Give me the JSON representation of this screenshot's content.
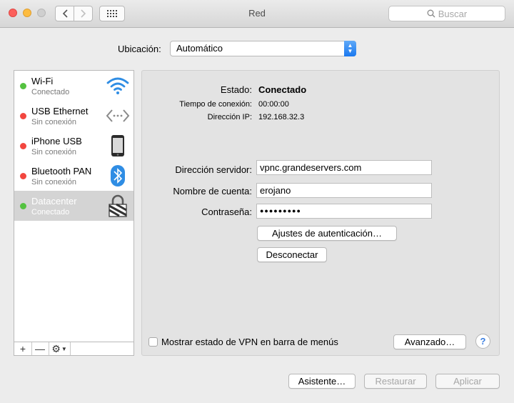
{
  "window": {
    "title": "Red",
    "search_placeholder": "Buscar"
  },
  "location": {
    "label": "Ubicación:",
    "value": "Automático"
  },
  "services": [
    {
      "name": "Wi-Fi",
      "status": "Conectado",
      "dot": "green",
      "icon": "wifi-icon"
    },
    {
      "name": "USB Ethernet",
      "status": "Sin conexión",
      "dot": "red",
      "icon": "ethernet-icon"
    },
    {
      "name": "iPhone USB",
      "status": "Sin conexión",
      "dot": "red",
      "icon": "iphone-icon"
    },
    {
      "name": "Bluetooth PAN",
      "status": "Sin conexión",
      "dot": "red",
      "icon": "bluetooth-icon"
    },
    {
      "name": "Datacenter",
      "status": "Conectado",
      "dot": "green",
      "icon": "vpn-lock-icon",
      "selected": true
    }
  ],
  "sidebar_toolbar": {
    "add": "+",
    "remove": "—",
    "gear": "⚙"
  },
  "status": {
    "estado_label": "Estado:",
    "estado_value": "Conectado",
    "tiempo_label": "Tiempo de conexión:",
    "tiempo_value": "00:00:00",
    "ip_label": "Dirección IP:",
    "ip_value": "192.168.32.3"
  },
  "form": {
    "server_label": "Dirección servidor:",
    "server_value": "vpnc.grandeservers.com",
    "account_label": "Nombre de cuenta:",
    "account_value": "erojano",
    "password_label": "Contraseña:",
    "password_value": "●●●●●●●●●"
  },
  "buttons": {
    "auth": "Ajustes de autenticación…",
    "disconnect": "Desconectar",
    "advanced": "Avanzado…",
    "help": "?",
    "assistant": "Asistente…",
    "revert": "Restaurar",
    "apply": "Aplicar"
  },
  "vpn_menu_checkbox": {
    "label": "Mostrar estado de VPN en barra de menús",
    "checked": false
  },
  "colors": {
    "connected": "#54c240",
    "disconnected": "#f2463f",
    "accent": "#1a78ef"
  }
}
